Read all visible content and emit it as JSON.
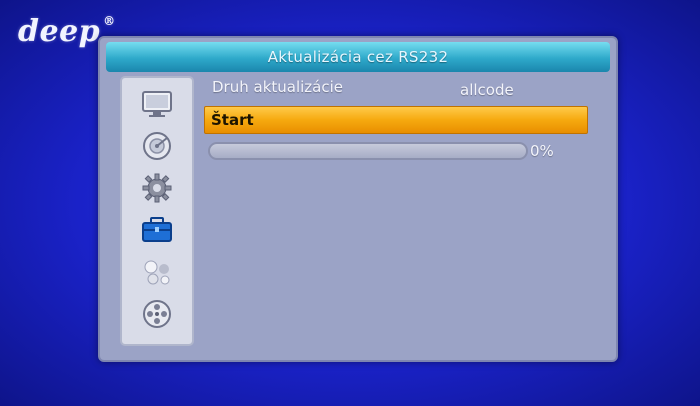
{
  "brand": {
    "name": "deep",
    "mark": "®"
  },
  "window": {
    "title": "Aktualizácia cez RS232"
  },
  "sidebar": {
    "icons": [
      {
        "name": "tv-icon"
      },
      {
        "name": "satellite-dish-icon"
      },
      {
        "name": "gear-icon"
      },
      {
        "name": "toolbox-icon"
      },
      {
        "name": "media-icon"
      },
      {
        "name": "film-reel-icon"
      }
    ],
    "selected_index": 3
  },
  "settings": {
    "update_type_label": "Druh aktualizácie",
    "update_type_value": "allcode",
    "start_label": "Štart"
  },
  "progress": {
    "value": 0,
    "text": "0%"
  },
  "colors": {
    "background": "#1a22c8",
    "highlight": "#f6a90f",
    "titlebar": "#2ea9ca",
    "panel": "#9ba3c6"
  }
}
